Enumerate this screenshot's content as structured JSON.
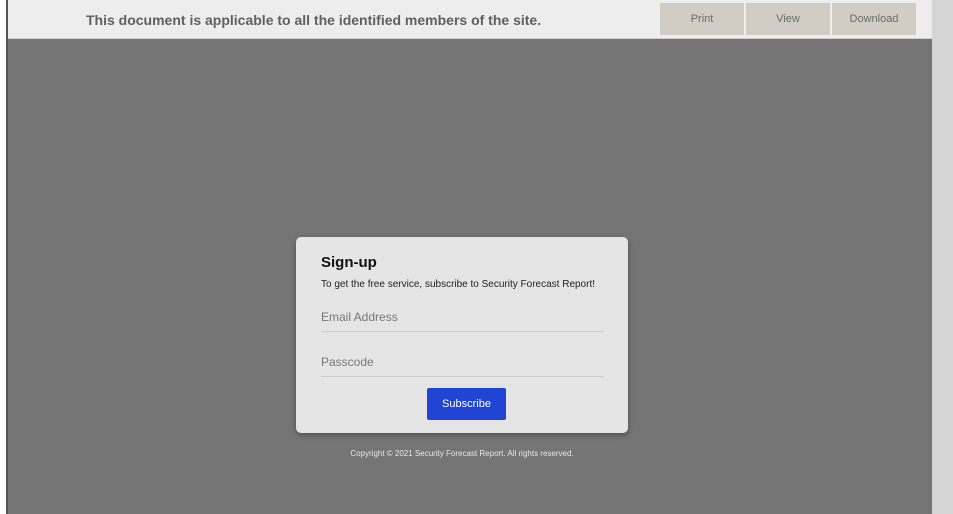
{
  "topbar": {
    "notice": "This document is applicable to all the identified members of the site.",
    "buttons": {
      "print": "Print",
      "view": "View",
      "download": "Download"
    }
  },
  "modal": {
    "title": "Sign-up",
    "subtitle": "To get the free service, subscribe to Security Forecast Report!",
    "email_placeholder": "Email Address",
    "passcode_placeholder": "Passcode",
    "submit_label": "Subscribe"
  },
  "footer": {
    "copyright": "Copyright © 2021 Security Forecast Report. All rights reserved."
  },
  "colors": {
    "overlay": "#757575",
    "accent": "#2044d4",
    "toolbar_button": "#d0cdc4"
  }
}
